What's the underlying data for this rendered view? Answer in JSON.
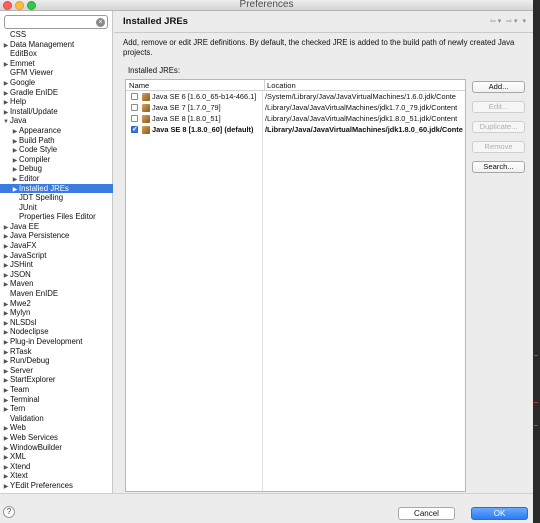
{
  "window": {
    "title": "Preferences"
  },
  "filter": {
    "value": "",
    "clear_icon": "clear-icon"
  },
  "tree": [
    {
      "label": "CSS",
      "arrow": "",
      "indent": 0
    },
    {
      "label": "Data Management",
      "arrow": "▶",
      "indent": 0
    },
    {
      "label": "EditBox",
      "arrow": "",
      "indent": 0
    },
    {
      "label": "Emmet",
      "arrow": "▶",
      "indent": 0
    },
    {
      "label": "GFM Viewer",
      "arrow": "",
      "indent": 0
    },
    {
      "label": "Google",
      "arrow": "▶",
      "indent": 0
    },
    {
      "label": "Gradle EnIDE",
      "arrow": "▶",
      "indent": 0
    },
    {
      "label": "Help",
      "arrow": "▶",
      "indent": 0
    },
    {
      "label": "Install/Update",
      "arrow": "▶",
      "indent": 0
    },
    {
      "label": "Java",
      "arrow": "▼",
      "indent": 0
    },
    {
      "label": "Appearance",
      "arrow": "▶",
      "indent": 1
    },
    {
      "label": "Build Path",
      "arrow": "▶",
      "indent": 1
    },
    {
      "label": "Code Style",
      "arrow": "▶",
      "indent": 1
    },
    {
      "label": "Compiler",
      "arrow": "▶",
      "indent": 1
    },
    {
      "label": "Debug",
      "arrow": "▶",
      "indent": 1
    },
    {
      "label": "Editor",
      "arrow": "▶",
      "indent": 1
    },
    {
      "label": "Installed JREs",
      "arrow": "▶",
      "indent": 1,
      "selected": true
    },
    {
      "label": "JDT Spelling",
      "arrow": "",
      "indent": 1
    },
    {
      "label": "JUnit",
      "arrow": "",
      "indent": 1
    },
    {
      "label": "Properties Files Editor",
      "arrow": "",
      "indent": 1
    },
    {
      "label": "Java EE",
      "arrow": "▶",
      "indent": 0
    },
    {
      "label": "Java Persistence",
      "arrow": "▶",
      "indent": 0
    },
    {
      "label": "JavaFX",
      "arrow": "▶",
      "indent": 0
    },
    {
      "label": "JavaScript",
      "arrow": "▶",
      "indent": 0
    },
    {
      "label": "JSHint",
      "arrow": "▶",
      "indent": 0
    },
    {
      "label": "JSON",
      "arrow": "▶",
      "indent": 0
    },
    {
      "label": "Maven",
      "arrow": "▶",
      "indent": 0
    },
    {
      "label": "Maven EnIDE",
      "arrow": "",
      "indent": 0
    },
    {
      "label": "Mwe2",
      "arrow": "▶",
      "indent": 0
    },
    {
      "label": "Mylyn",
      "arrow": "▶",
      "indent": 0
    },
    {
      "label": "NLSDsl",
      "arrow": "▶",
      "indent": 0
    },
    {
      "label": "Nodeclipse",
      "arrow": "▶",
      "indent": 0
    },
    {
      "label": "Plug-in Development",
      "arrow": "▶",
      "indent": 0
    },
    {
      "label": "RTask",
      "arrow": "▶",
      "indent": 0
    },
    {
      "label": "Run/Debug",
      "arrow": "▶",
      "indent": 0
    },
    {
      "label": "Server",
      "arrow": "▶",
      "indent": 0
    },
    {
      "label": "StartExplorer",
      "arrow": "▶",
      "indent": 0
    },
    {
      "label": "Team",
      "arrow": "▶",
      "indent": 0
    },
    {
      "label": "Terminal",
      "arrow": "▶",
      "indent": 0
    },
    {
      "label": "Tern",
      "arrow": "▶",
      "indent": 0
    },
    {
      "label": "Validation",
      "arrow": "",
      "indent": 0
    },
    {
      "label": "Web",
      "arrow": "▶",
      "indent": 0
    },
    {
      "label": "Web Services",
      "arrow": "▶",
      "indent": 0
    },
    {
      "label": "WindowBuilder",
      "arrow": "▶",
      "indent": 0
    },
    {
      "label": "XML",
      "arrow": "▶",
      "indent": 0
    },
    {
      "label": "Xtend",
      "arrow": "▶",
      "indent": 0
    },
    {
      "label": "Xtext",
      "arrow": "▶",
      "indent": 0
    },
    {
      "label": "YEdit Preferences",
      "arrow": "▶",
      "indent": 0
    }
  ],
  "page": {
    "title": "Installed JREs",
    "nav": {
      "back": "⇦ ▾",
      "forward": "⇨ ▾",
      "menu": "▾"
    },
    "description": "Add, remove or edit JRE definitions. By default, the checked JRE is added to the build path of newly created Java projects.",
    "installed_label": "Installed JREs:",
    "columns": {
      "name": "Name",
      "location": "Location"
    },
    "jres": [
      {
        "name": "Java SE 6 [1.6.0_65-b14-466.1]",
        "location": "/System/Library/Java/JavaVirtualMachines/1.6.0.jdk/Conte",
        "checked": false,
        "bold": false
      },
      {
        "name": "Java SE 7 [1.7.0_79]",
        "location": "/Library/Java/JavaVirtualMachines/jdk1.7.0_79.jdk/Content",
        "checked": false,
        "bold": false
      },
      {
        "name": "Java SE 8 [1.8.0_51]",
        "location": "/Library/Java/JavaVirtualMachines/jdk1.8.0_51.jdk/Content",
        "checked": false,
        "bold": false
      },
      {
        "name": "Java SE 8 [1.8.0_60] (default)",
        "location": "/Library/Java/JavaVirtualMachines/jdk1.8.0_60.jdk/Conte",
        "checked": true,
        "bold": true
      }
    ],
    "buttons": {
      "add": "Add...",
      "edit": "Edit...",
      "duplicate": "Duplicate...",
      "remove": "Remove",
      "search": "Search..."
    }
  },
  "footer": {
    "help": "?",
    "cancel": "Cancel",
    "ok": "OK"
  },
  "colors": {
    "accent": "#3b7ae0",
    "ok_button": "#2c7cf0"
  }
}
